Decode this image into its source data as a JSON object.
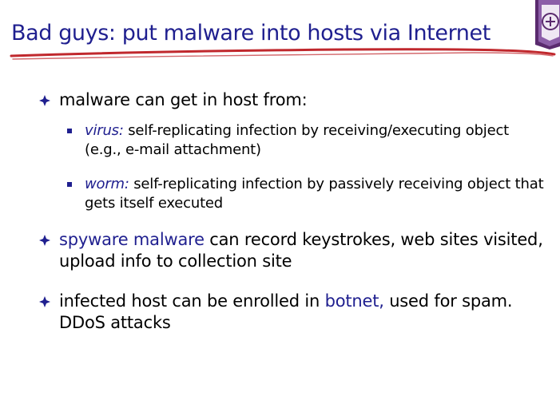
{
  "slide": {
    "title": "Bad guys: put malware into hosts via Internet",
    "bullets": [
      {
        "text": "malware can get in host from:",
        "sub_bullets": [
          {
            "term": "virus:",
            "text": " self-replicating infection by receiving/executing object (e.g., e-mail attachment)"
          },
          {
            "term": "worm:",
            "text": " self-replicating infection by passively receiving object that gets itself executed"
          }
        ]
      },
      {
        "highlight": "spyware malware",
        "text": " can record keystrokes, web sites visited, upload info to collection site"
      },
      {
        "text_before": "infected host can be enrolled in ",
        "highlight": "botnet,",
        "text_after": " used for spam. DDoS attacks"
      }
    ]
  },
  "colors": {
    "title": "#1f1f8f",
    "accent": "#1f1f8f",
    "underline": "#c0282d",
    "body_text": "#000000"
  },
  "icons": {
    "bullet": "diamond-bullet-icon",
    "sub_bullet": "square-bullet-icon",
    "logo": "university-crest-icon"
  }
}
